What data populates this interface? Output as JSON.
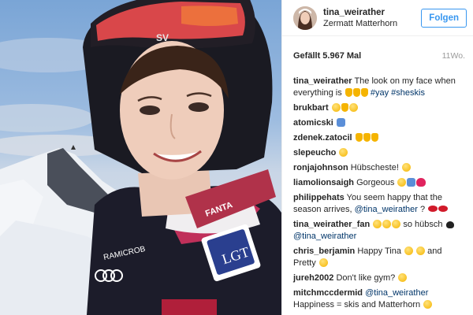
{
  "header": {
    "username": "tina_weirather",
    "location": "Zermatt Matterhorn",
    "follow_label": "Folgen"
  },
  "stats": {
    "likes": "Gefällt 5.967 Mal",
    "age": "11Wo."
  },
  "comments": [
    {
      "user": "tina_weirather",
      "text": "The look on my face when everything is",
      "tail": "#yay #sheskis",
      "emoji": [
        "hand",
        "hand",
        "hand"
      ]
    },
    {
      "user": "brukbart",
      "text": "",
      "emoji": [
        "face",
        "hand",
        "face"
      ]
    },
    {
      "user": "atomicski",
      "text": "",
      "emoji": [
        "blue"
      ]
    },
    {
      "user": "zdenek.zatocil",
      "text": "",
      "emoji": [
        "hand",
        "hand",
        "hand"
      ]
    },
    {
      "user": "slepeucho",
      "text": "",
      "emoji": [
        "face"
      ]
    },
    {
      "user": "ronjajohnson",
      "text": "Hübscheste!",
      "emoji": [
        "face"
      ]
    },
    {
      "user": "liamolionsaigh",
      "text": "Gorgeous",
      "emoji": [
        "face",
        "blue",
        "heart"
      ]
    },
    {
      "user": "philippehats",
      "text": "You seem happy that the season arrives,",
      "mention": "@tina_weirather",
      "text2": "?",
      "emoji": [
        "lips",
        "lips"
      ]
    },
    {
      "user": "tina_weirather_fan",
      "text": "so hübsch",
      "mention": "@tina_weirather",
      "emoji": [
        "face",
        "face",
        "face"
      ]
    },
    {
      "user": "chris_berjamin",
      "text": "Happy Tina",
      "text2": "and Pretty",
      "emoji": [
        "face",
        "face",
        "face"
      ]
    },
    {
      "user": "jureh2002",
      "text": "Don't like gym?",
      "emoji": [
        "face"
      ]
    },
    {
      "user": "mitchmccdermid",
      "mention": "@tina_weirather",
      "text2": "Happiness = skis and Matterhorn",
      "emoji": [
        "face"
      ]
    }
  ],
  "photo": {
    "helmet_text": "SV",
    "sponsor_text": "RAMICROB",
    "badge_text": "LGT",
    "collar_text": "FANTA"
  },
  "colors": {
    "accent": "#3897f0",
    "tag": "#003569",
    "muted": "#999999"
  }
}
